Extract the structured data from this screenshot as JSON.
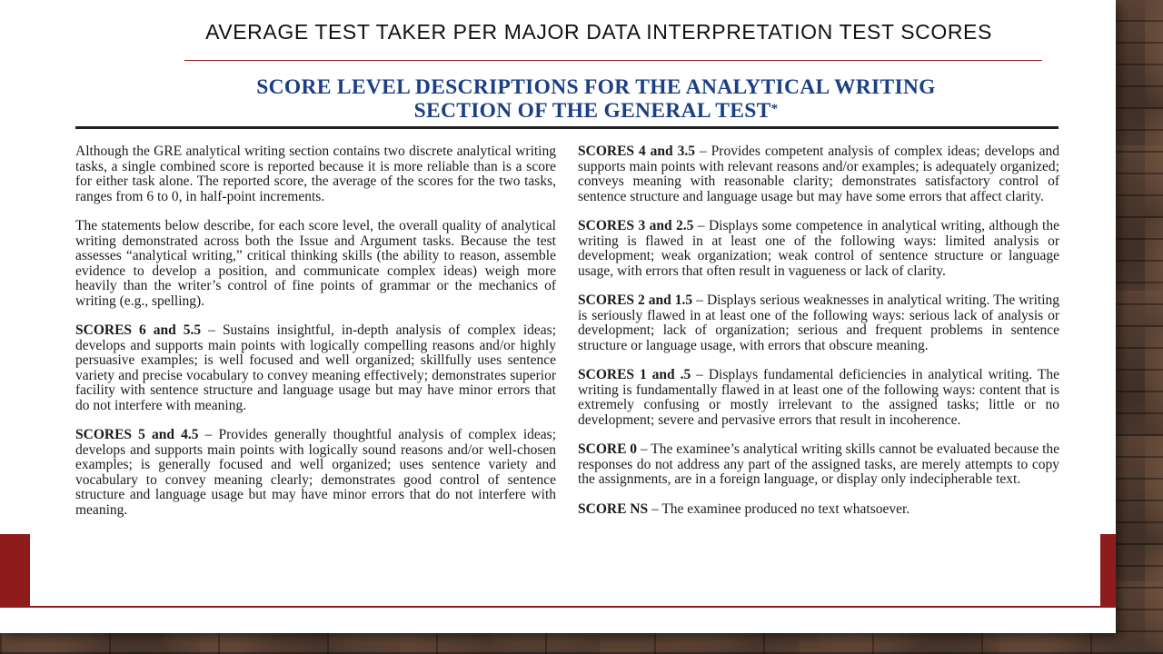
{
  "slide": {
    "title": "AVERAGE TEST TAKER PER MAJOR DATA INTERPRETATION TEST SCORES"
  },
  "document": {
    "heading_line1": "SCORE LEVEL DESCRIPTIONS FOR THE ANALYTICAL WRITING",
    "heading_line2": "SECTION OF THE GENERAL TEST",
    "heading_mark": "*",
    "left_column": [
      {
        "lead": "",
        "text": "Although the GRE analytical writing section contains two discrete analytical writing tasks, a single combined score is reported because it is more reliable than is a score for either task alone. The reported score, the average of the scores for the two tasks, ranges from 6 to 0, in half-point increments."
      },
      {
        "lead": "",
        "text": "The statements below describe, for each score level, the overall quality of analytical writing demonstrated across both the Issue and Argument tasks. Because the test assesses “analytical writing,” critical thinking skills (the ability to reason, assemble evidence to develop a position, and communicate complex ideas) weigh more heavily than the writer’s control of fine points of grammar or the mechanics of writing (e.g., spelling)."
      },
      {
        "lead": "SCORES 6 and 5.5",
        "text": " – Sustains insightful, in-depth analysis of complex ideas; develops and supports main points with logically compelling reasons and/or highly persuasive examples; is well focused and well organized; skillfully uses sentence variety and precise vocabulary to convey meaning effectively; demonstrates superior facility with sentence structure and language usage but may have minor errors that do not interfere with meaning."
      },
      {
        "lead": "SCORES 5 and 4.5",
        "text": " – Provides generally thoughtful analysis of complex ideas; develops and supports main points with logically sound reasons and/or well-chosen examples; is generally focused and well organized; uses sentence variety and vocabulary to convey meaning clearly; demonstrates good control of sentence structure and language usage but may have minor errors that do not interfere with meaning."
      }
    ],
    "right_column": [
      {
        "lead": "SCORES 4 and 3.5",
        "text": " – Provides competent analysis of complex ideas; develops and supports main points with relevant reasons and/or examples; is adequately organized; conveys meaning with reasonable clarity; demonstrates satisfactory control of sentence structure and language usage but may have some errors that affect clarity."
      },
      {
        "lead": "SCORES 3 and 2.5",
        "text": " – Displays some competence in analytical writing, although the writing is flawed in at least one of the following ways: limited analysis or development; weak organization; weak control of sentence structure or language usage, with errors that often result in vagueness or lack of clarity."
      },
      {
        "lead": "SCORES 2 and 1.5",
        "text": " – Displays serious weaknesses in analytical writing. The writing is seriously flawed in at least one of the following ways: serious lack of analysis or development; lack of organization; serious and frequent problems in sentence structure or language usage, with errors that obscure meaning."
      },
      {
        "lead": "SCORES 1 and .5",
        "text": " – Displays fundamental deficiencies in analytical writing. The writing is fundamentally flawed in at least one of the following ways: content that is extremely confusing or mostly irrelevant to the assigned tasks; little or no development; severe and pervasive errors that result in incoherence."
      },
      {
        "lead": "SCORE 0",
        "text": " – The examinee’s analytical writing skills cannot be evaluated because the responses do not address any part of the assigned tasks, are merely attempts to copy the assignments, are in a foreign language, or display only indecipherable text."
      },
      {
        "lead": "SCORE NS",
        "text": " – The examinee produced no text whatsoever."
      }
    ]
  },
  "colors": {
    "heading": "#1b3f85",
    "accent_red": "#8e1c1c"
  }
}
